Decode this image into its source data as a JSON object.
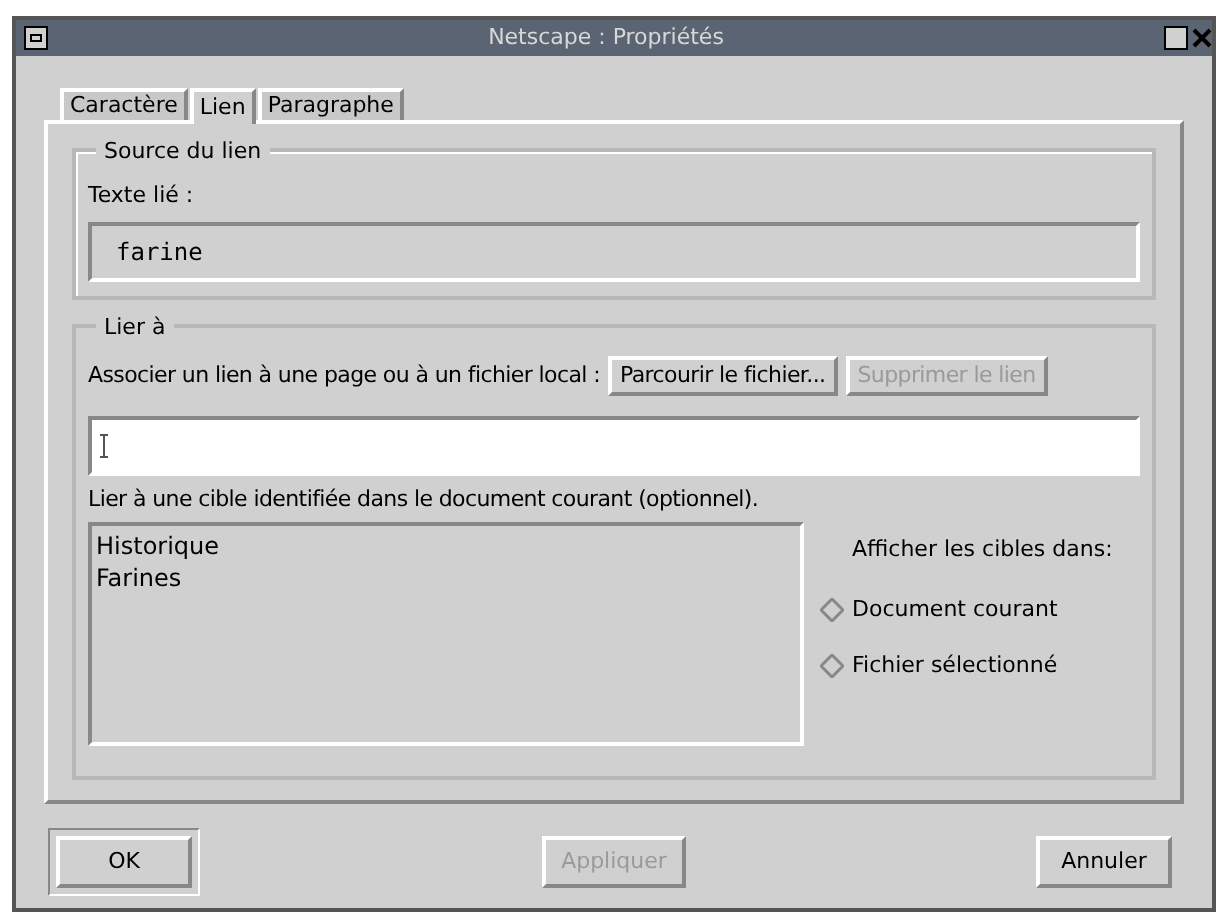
{
  "window": {
    "title": "Netscape : Propriétés"
  },
  "tabs": [
    {
      "label": "Caractère",
      "selected": false
    },
    {
      "label": "Lien",
      "selected": true
    },
    {
      "label": "Paragraphe",
      "selected": false
    }
  ],
  "source": {
    "legend": "Source du lien",
    "label": "Texte lié :",
    "value": "farine"
  },
  "link_to": {
    "legend": "Lier à",
    "label": "Associer un lien à une page ou à un fichier local :",
    "buttons": [
      {
        "label": "Parcourir le fichier...",
        "disabled": false
      },
      {
        "label": "Supprimer le lien",
        "disabled": true
      }
    ],
    "targets_label": "Lier à une cible identifiée dans le document courant (optionnel).",
    "targets": [
      "Historique",
      "Farines"
    ],
    "show_label": "Afficher les cibles dans:",
    "show_options": [
      {
        "label": "Document courant",
        "selected": false
      },
      {
        "label": "Fichier sélectionné",
        "selected": false
      }
    ]
  },
  "buttons": [
    {
      "label": "OK",
      "disabled": false,
      "default": true
    },
    {
      "label": "Appliquer",
      "disabled": true,
      "default": false
    },
    {
      "label": "Annuler",
      "disabled": false,
      "default": false
    }
  ]
}
